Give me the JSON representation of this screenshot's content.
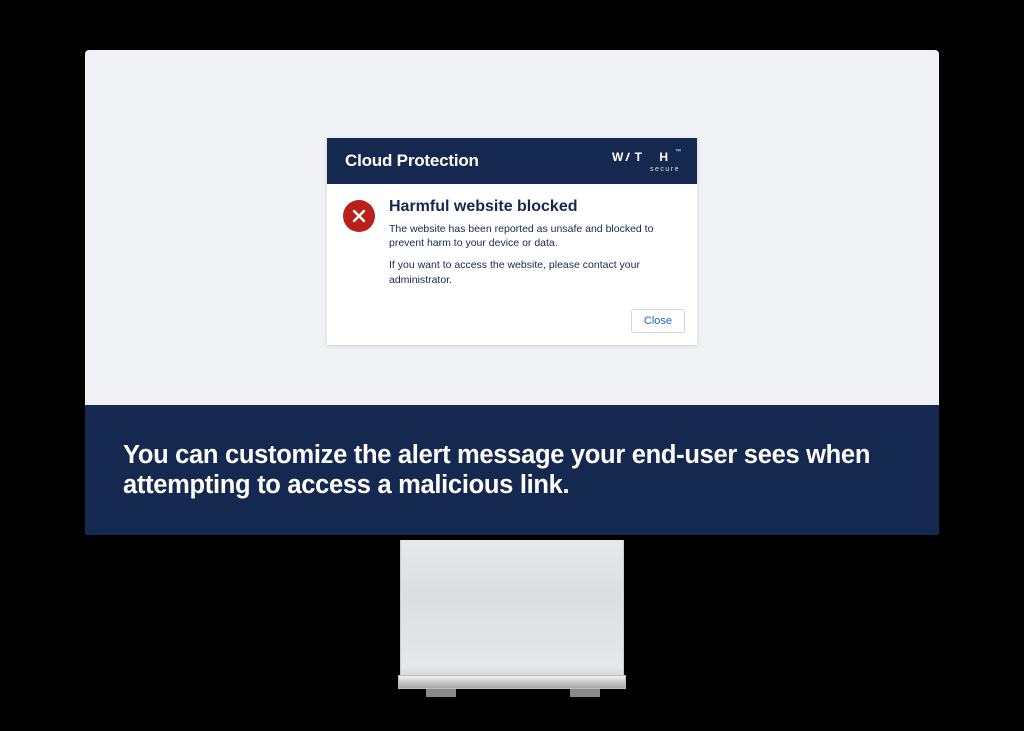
{
  "dialog": {
    "header_title": "Cloud Protection",
    "brand_main": "W",
    "brand_main2": "T H",
    "brand_sub": "secure",
    "heading": "Harmful website blocked",
    "para1": "The website has been reported as unsafe and blocked to prevent harm to your device or data.",
    "para2": "If you want to access the website, please contact your administrator.",
    "close_label": "Close"
  },
  "banner": {
    "text": "You can customize the alert message your end-user sees when attempting to access a malicious link."
  },
  "icons": {
    "danger": "danger-x-icon"
  },
  "colors": {
    "brand_navy": "#152850",
    "danger_red": "#b91f1b",
    "screen_bg": "#f0f2f6",
    "link_blue": "#1765cc"
  }
}
